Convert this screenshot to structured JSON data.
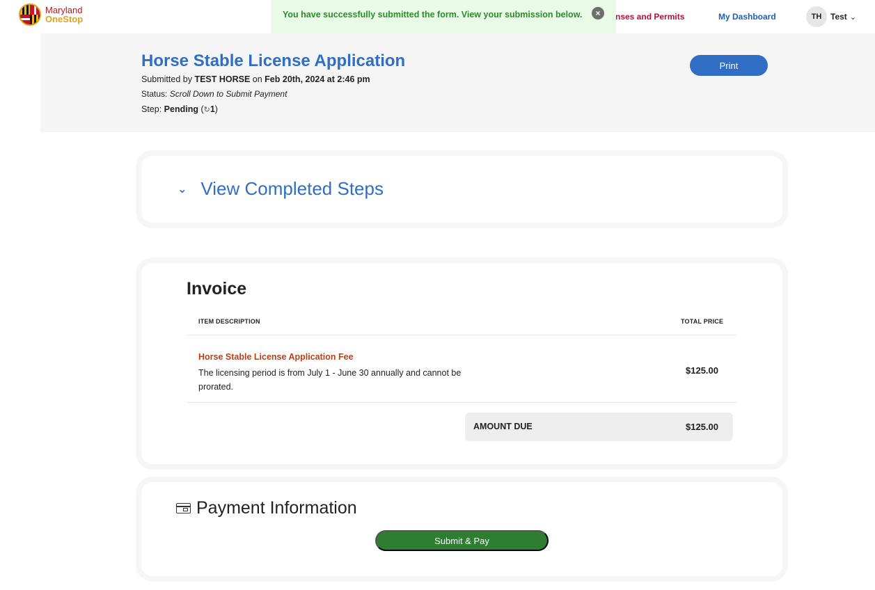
{
  "nav": {
    "logo": {
      "line1": "Maryland",
      "line2": "OneStop"
    },
    "licenses_link": "nses and Permits",
    "dashboard_link": "My Dashboard",
    "user": {
      "initials": "TH",
      "name": "Test"
    }
  },
  "toast": {
    "message": "You have successfully submitted the form. View your submission below."
  },
  "header": {
    "title": "Horse Stable License Application",
    "submitted_prefix": "Submitted by ",
    "submitted_by": "TEST HORSE",
    "submitted_on_word": " on ",
    "submitted_date": "Feb 20th, 2024 at 2:46 pm",
    "status_label": "Status: ",
    "status_value": "Scroll Down to Submit Payment",
    "step_label": "Step: ",
    "step_value": "Pending",
    "step_count": "1",
    "print_label": "Print"
  },
  "steps": {
    "toggle_label": "View Completed Steps"
  },
  "invoice": {
    "title": "Invoice",
    "col_description": "ITEM DESCRIPTION",
    "col_price": "TOTAL PRICE",
    "item": {
      "name": "Horse Stable License Application Fee",
      "description": "The licensing period is from July 1 - June 30 annually and cannot be prorated.",
      "price": "$125.00"
    },
    "amount_due_label": "AMOUNT DUE",
    "amount_due_value": "$125.00"
  },
  "payment": {
    "title": "Payment Information",
    "submit_label": "Submit & Pay"
  },
  "colors": {
    "primary_blue": "#2f6ec4",
    "success_green": "#2e7d32",
    "toast_bg": "#e9fbe6",
    "item_name": "#b5401a",
    "nav_red": "#b0123b"
  }
}
